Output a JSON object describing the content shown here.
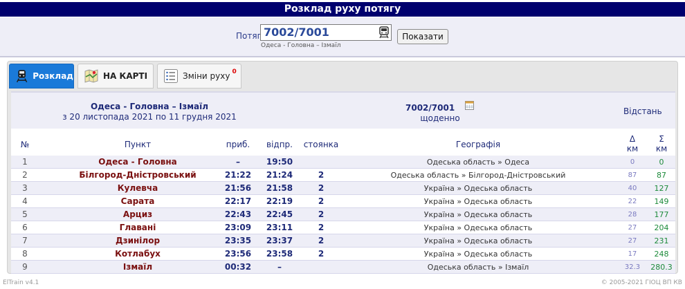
{
  "header": {
    "title": "Розклад руху потягу"
  },
  "search": {
    "label": "Потяг",
    "value": "7002/7001",
    "route_hint": "Одеса - Головна – Ізмаїл",
    "button": "Показати"
  },
  "tabs": [
    {
      "label": "Розклад",
      "icon": "train-icon",
      "active": true
    },
    {
      "label": "НА КАРТІ",
      "icon": "map-icon",
      "active": false
    },
    {
      "label": "Зміни руху",
      "icon": "list-icon",
      "badge": "0",
      "active": false
    }
  ],
  "info": {
    "route": "Одеса - Головна – Ізмаїл",
    "period": "з 20 листопада 2021 по 11 грудня 2021",
    "train": "7002/7001",
    "days": "щоденно",
    "distance": "Відстань"
  },
  "columns": {
    "num": "№",
    "stop": "Пункт",
    "arr": "приб.",
    "dep": "відпр.",
    "halt": "стоянка",
    "geo": "Географія",
    "d_sym": "Δ",
    "d_unit": "км",
    "s_sym": "Σ",
    "s_unit": "км"
  },
  "rows": [
    {
      "num": "1",
      "stop": "Одеса - Головна",
      "arr": "–",
      "dep": "19:50",
      "halt": "",
      "geo": "Одеська область » Одеса",
      "delta": "0",
      "sum": "0"
    },
    {
      "num": "2",
      "stop": "Білгород-Дністровський",
      "arr": "21:22",
      "dep": "21:24",
      "halt": "2",
      "geo": "Одеська область » Білгород-Дністровський",
      "delta": "87",
      "sum": "87"
    },
    {
      "num": "3",
      "stop": "Кулевча",
      "arr": "21:56",
      "dep": "21:58",
      "halt": "2",
      "geo": "Україна » Одеська область",
      "delta": "40",
      "sum": "127"
    },
    {
      "num": "4",
      "stop": "Сарата",
      "arr": "22:17",
      "dep": "22:19",
      "halt": "2",
      "geo": "Україна » Одеська область",
      "delta": "22",
      "sum": "149"
    },
    {
      "num": "5",
      "stop": "Арциз",
      "arr": "22:43",
      "dep": "22:45",
      "halt": "2",
      "geo": "Україна » Одеська область",
      "delta": "28",
      "sum": "177"
    },
    {
      "num": "6",
      "stop": "Главані",
      "arr": "23:09",
      "dep": "23:11",
      "halt": "2",
      "geo": "Україна » Одеська область",
      "delta": "27",
      "sum": "204"
    },
    {
      "num": "7",
      "stop": "Дзинілор",
      "arr": "23:35",
      "dep": "23:37",
      "halt": "2",
      "geo": "Україна » Одеська область",
      "delta": "27",
      "sum": "231"
    },
    {
      "num": "8",
      "stop": "Котлабух",
      "arr": "23:56",
      "dep": "23:58",
      "halt": "2",
      "geo": "Україна » Одеська область",
      "delta": "17",
      "sum": "248"
    },
    {
      "num": "9",
      "stop": "Ізмаїл",
      "arr": "00:32",
      "dep": "–",
      "halt": "",
      "geo": "Одеська область » Ізмаїл",
      "delta": "32.3",
      "sum": "280.3"
    }
  ],
  "footer": {
    "left": "ElTrain v4.1",
    "right": "© 2005-2021 ГІОЦ ВП КВ"
  }
}
